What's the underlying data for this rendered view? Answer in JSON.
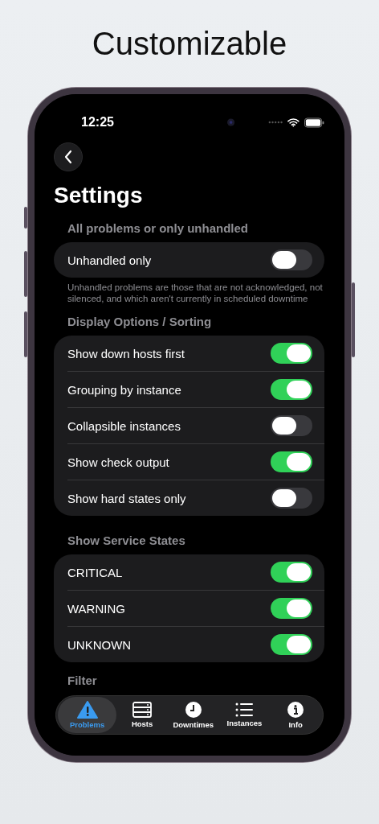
{
  "page_title": "Customizable",
  "status_bar": {
    "time": "12:25"
  },
  "nav": {
    "title": "Settings"
  },
  "sections": [
    {
      "header": "All problems or only unhandled",
      "rows": [
        {
          "label": "Unhandled only",
          "on": false
        }
      ],
      "footer": "Unhandled problems are those that are not acknowledged, not silenced, and which aren't currently in scheduled downtime"
    },
    {
      "header": "Display Options / Sorting",
      "rows": [
        {
          "label": "Show down hosts first",
          "on": true
        },
        {
          "label": "Grouping by instance",
          "on": true
        },
        {
          "label": "Collapsible instances",
          "on": false
        },
        {
          "label": "Show check output",
          "on": true
        },
        {
          "label": "Show hard states only",
          "on": false
        }
      ]
    },
    {
      "header": "Show Service States",
      "rows": [
        {
          "label": "CRITICAL",
          "on": true
        },
        {
          "label": "WARNING",
          "on": true
        },
        {
          "label": "UNKNOWN",
          "on": true
        }
      ]
    },
    {
      "header": "Filter"
    }
  ],
  "tab_bar": [
    {
      "label": "Problems",
      "selected": true
    },
    {
      "label": "Hosts",
      "selected": false
    },
    {
      "label": "Downtimes",
      "selected": false
    },
    {
      "label": "Instances",
      "selected": false
    },
    {
      "label": "Info",
      "selected": false
    }
  ]
}
